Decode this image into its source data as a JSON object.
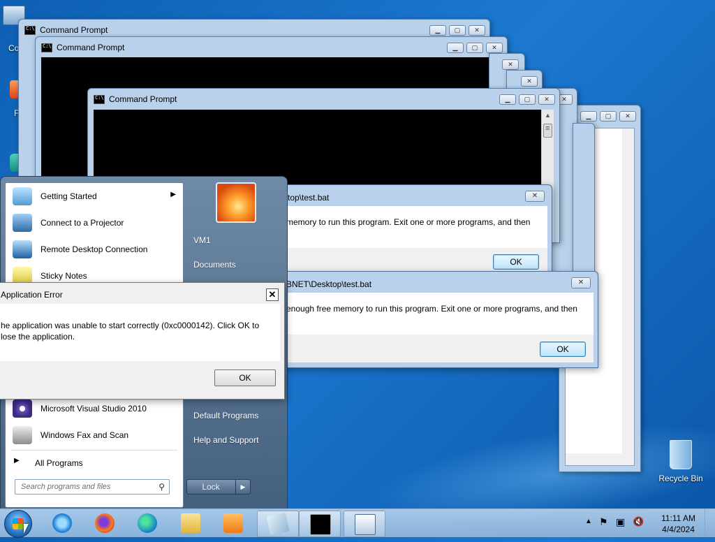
{
  "desktop": {
    "icons": [
      {
        "label": "Co"
      },
      {
        "label": "F"
      },
      {
        "label": "Recycle Bin"
      }
    ]
  },
  "cmd_windows": [
    {
      "title": "Command Prompt"
    },
    {
      "title": "Command Prompt"
    },
    {
      "title": "Command Prompt"
    }
  ],
  "error_dialogs": [
    {
      "title": "top\\test.bat",
      "message": "memory to run this program. Exit one or more programs, and then",
      "ok": "OK"
    },
    {
      "title": "BNET\\Desktop\\test.bat",
      "message": "enough free memory to run this program. Exit one or more programs, and then",
      "ok": "OK"
    }
  ],
  "app_error": {
    "title": "Application Error",
    "message_line1": "he application was unable to start correctly (0xc0000142). Click OK to",
    "message_line2": "lose the application.",
    "ok": "OK"
  },
  "start_menu": {
    "programs": [
      {
        "label": "Getting Started",
        "has_submenu": true
      },
      {
        "label": "Connect to a Projector"
      },
      {
        "label": "Remote Desktop Connection"
      },
      {
        "label": "Sticky Notes"
      },
      {
        "label": "Microsoft Visual Studio 2010"
      },
      {
        "label": "Windows Fax and Scan"
      }
    ],
    "all_programs": "All Programs",
    "search_placeholder": "Search programs and files",
    "right_items": {
      "user": "VM1",
      "documents": "Documents",
      "default_programs": "Default Programs",
      "help": "Help and Support"
    },
    "lock_label": "Lock"
  },
  "taskbar": {
    "time": "11:11 AM",
    "date": "4/4/2024"
  }
}
